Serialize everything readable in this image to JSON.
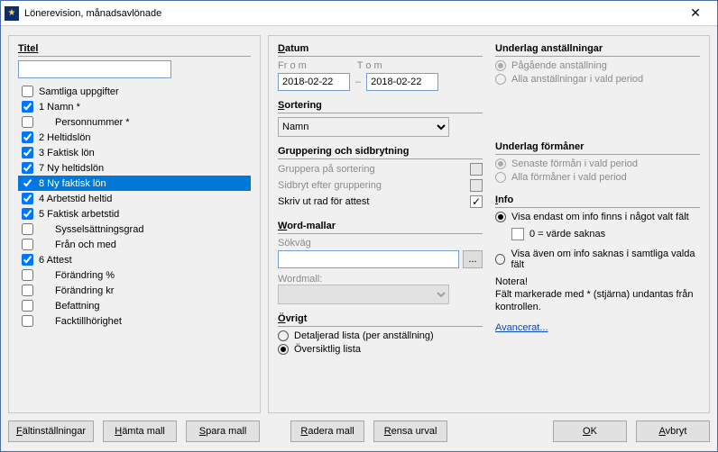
{
  "window": {
    "title": "Lönerevision, månadsavlönade",
    "icon": "★"
  },
  "left": {
    "title": "Titel",
    "input_value": "",
    "items": [
      {
        "label": "Samtliga uppgifter",
        "checked": false,
        "indent": false
      },
      {
        "label": "1 Namn *",
        "checked": true,
        "indent": false
      },
      {
        "label": "Personnummer *",
        "checked": false,
        "indent": true
      },
      {
        "label": "2 Heltidslön",
        "checked": true,
        "indent": false
      },
      {
        "label": "3 Faktisk lön",
        "checked": true,
        "indent": false
      },
      {
        "label": "7 Ny heltidslön",
        "checked": true,
        "indent": false
      },
      {
        "label": "8 Ny faktisk lön",
        "checked": true,
        "indent": false,
        "selected": true
      },
      {
        "label": "4 Arbetstid heltid",
        "checked": true,
        "indent": false
      },
      {
        "label": "5 Faktisk arbetstid",
        "checked": true,
        "indent": false
      },
      {
        "label": "Sysselsättningsgrad",
        "checked": false,
        "indent": true
      },
      {
        "label": "Från och med",
        "checked": false,
        "indent": true
      },
      {
        "label": "6 Attest",
        "checked": true,
        "indent": false
      },
      {
        "label": "Förändring %",
        "checked": false,
        "indent": true
      },
      {
        "label": "Förändring kr",
        "checked": false,
        "indent": true
      },
      {
        "label": "Befattning",
        "checked": false,
        "indent": true
      },
      {
        "label": "Facktillhörighet",
        "checked": false,
        "indent": true
      }
    ]
  },
  "datum": {
    "title": "Datum",
    "from_label": "Fr o m",
    "to_label": "T o m",
    "from_value": "2018-02-22",
    "to_value": "2018-02-22"
  },
  "sortering": {
    "title": "Sortering",
    "value": "Namn"
  },
  "gruppering": {
    "title": "Gruppering och sidbrytning",
    "line1": "Gruppera på sortering",
    "line2": "Sidbryt efter gruppering",
    "line3": "Skriv ut rad för attest"
  },
  "word": {
    "title": "Word-mallar",
    "path_label": "Sökväg",
    "path_value": "",
    "template_label": "Wordmall:",
    "browse": "..."
  },
  "ovrigt": {
    "title": "Övrigt",
    "opt1": "Detaljerad lista (per anställning)",
    "opt2": "Översiktlig lista"
  },
  "anst": {
    "title": "Underlag anställningar",
    "opt1": "Pågående anställning",
    "opt2": "Alla anställningar i vald period"
  },
  "forman": {
    "title": "Underlag förmåner",
    "opt1": "Senaste förmån i vald period",
    "opt2": "Alla förmåner i vald period"
  },
  "info": {
    "title": "Info",
    "opt1": "Visa endast om info finns i något valt fält",
    "chk": "0 = värde saknas",
    "opt2": "Visa även om info saknas i samtliga valda fält",
    "note_title": "Notera!",
    "note_body": "Fält markerade med * (stjärna) undantas från kontrollen.",
    "advanced": "Avancerat..."
  },
  "buttons": {
    "falt": "Fältinställningar",
    "hamta": "Hämta mall",
    "spara": "Spara mall",
    "radera": "Radera mall",
    "rensa": "Rensa urval",
    "ok": "OK",
    "avbryt": "Avbryt"
  }
}
